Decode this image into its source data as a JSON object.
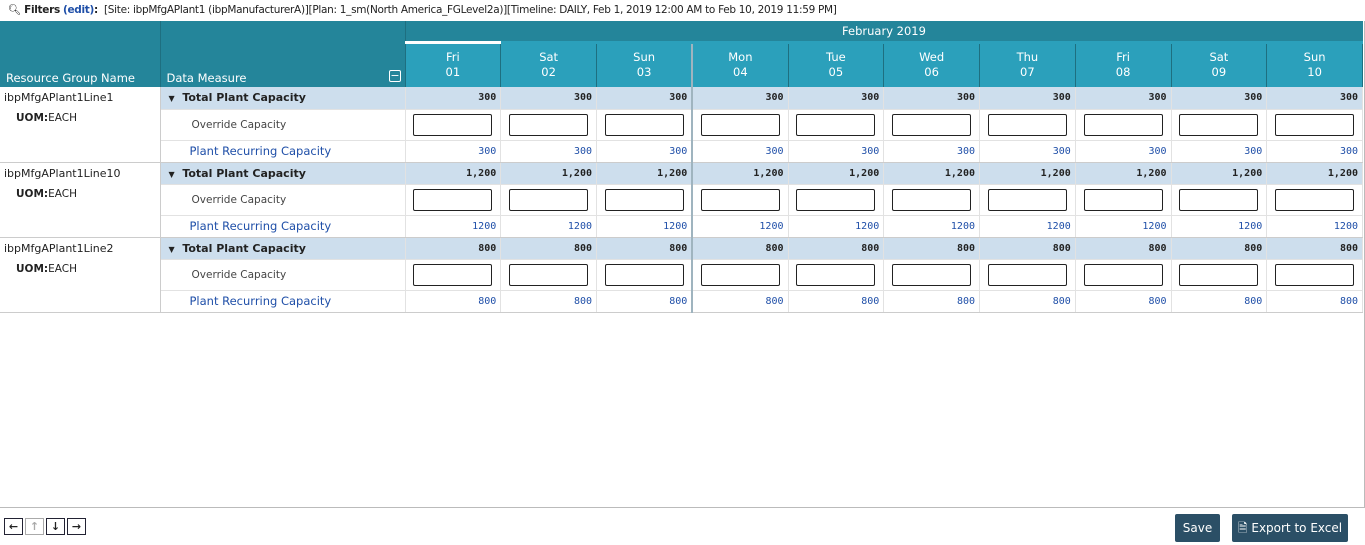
{
  "filters": {
    "label": "Filters",
    "edit": "(edit)",
    "text": "[Site: ibpMfgAPlant1 (ibpManufacturerA)][Plan: 1_sm(North America_FGLevel2a)][Timeline: DAILY, Feb 1, 2019 12:00 AM to Feb 10, 2019 11:59 PM]"
  },
  "header": {
    "resource_group": "Resource Group Name",
    "data_measure": "Data Measure",
    "month": "February 2019",
    "days": [
      {
        "dow": "Fri",
        "d": "01"
      },
      {
        "dow": "Sat",
        "d": "02"
      },
      {
        "dow": "Sun",
        "d": "03"
      },
      {
        "dow": "Mon",
        "d": "04"
      },
      {
        "dow": "Tue",
        "d": "05"
      },
      {
        "dow": "Wed",
        "d": "06"
      },
      {
        "dow": "Thu",
        "d": "07"
      },
      {
        "dow": "Fri",
        "d": "08"
      },
      {
        "dow": "Sat",
        "d": "09"
      },
      {
        "dow": "Sun",
        "d": "10"
      }
    ]
  },
  "groups": [
    {
      "name": "ibpMfgAPlant1Line1",
      "uom_label": "UOM:",
      "uom": "EACH",
      "total_label": "Total Plant Capacity",
      "total": "300",
      "override_label": "Override Capacity",
      "recurring_label": "Plant Recurring Capacity",
      "recurring": "300"
    },
    {
      "name": "ibpMfgAPlant1Line10",
      "uom_label": "UOM:",
      "uom": "EACH",
      "total_label": "Total Plant Capacity",
      "total": "1,200",
      "override_label": "Override Capacity",
      "recurring_label": "Plant Recurring Capacity",
      "recurring": "1200"
    },
    {
      "name": "ibpMfgAPlant1Line2",
      "uom_label": "UOM:",
      "uom": "EACH",
      "total_label": "Total Plant Capacity",
      "total": "800",
      "override_label": "Override Capacity",
      "recurring_label": "Plant Recurring Capacity",
      "recurring": "800"
    }
  ],
  "footer": {
    "save": "Save",
    "export": "Export to Excel"
  }
}
